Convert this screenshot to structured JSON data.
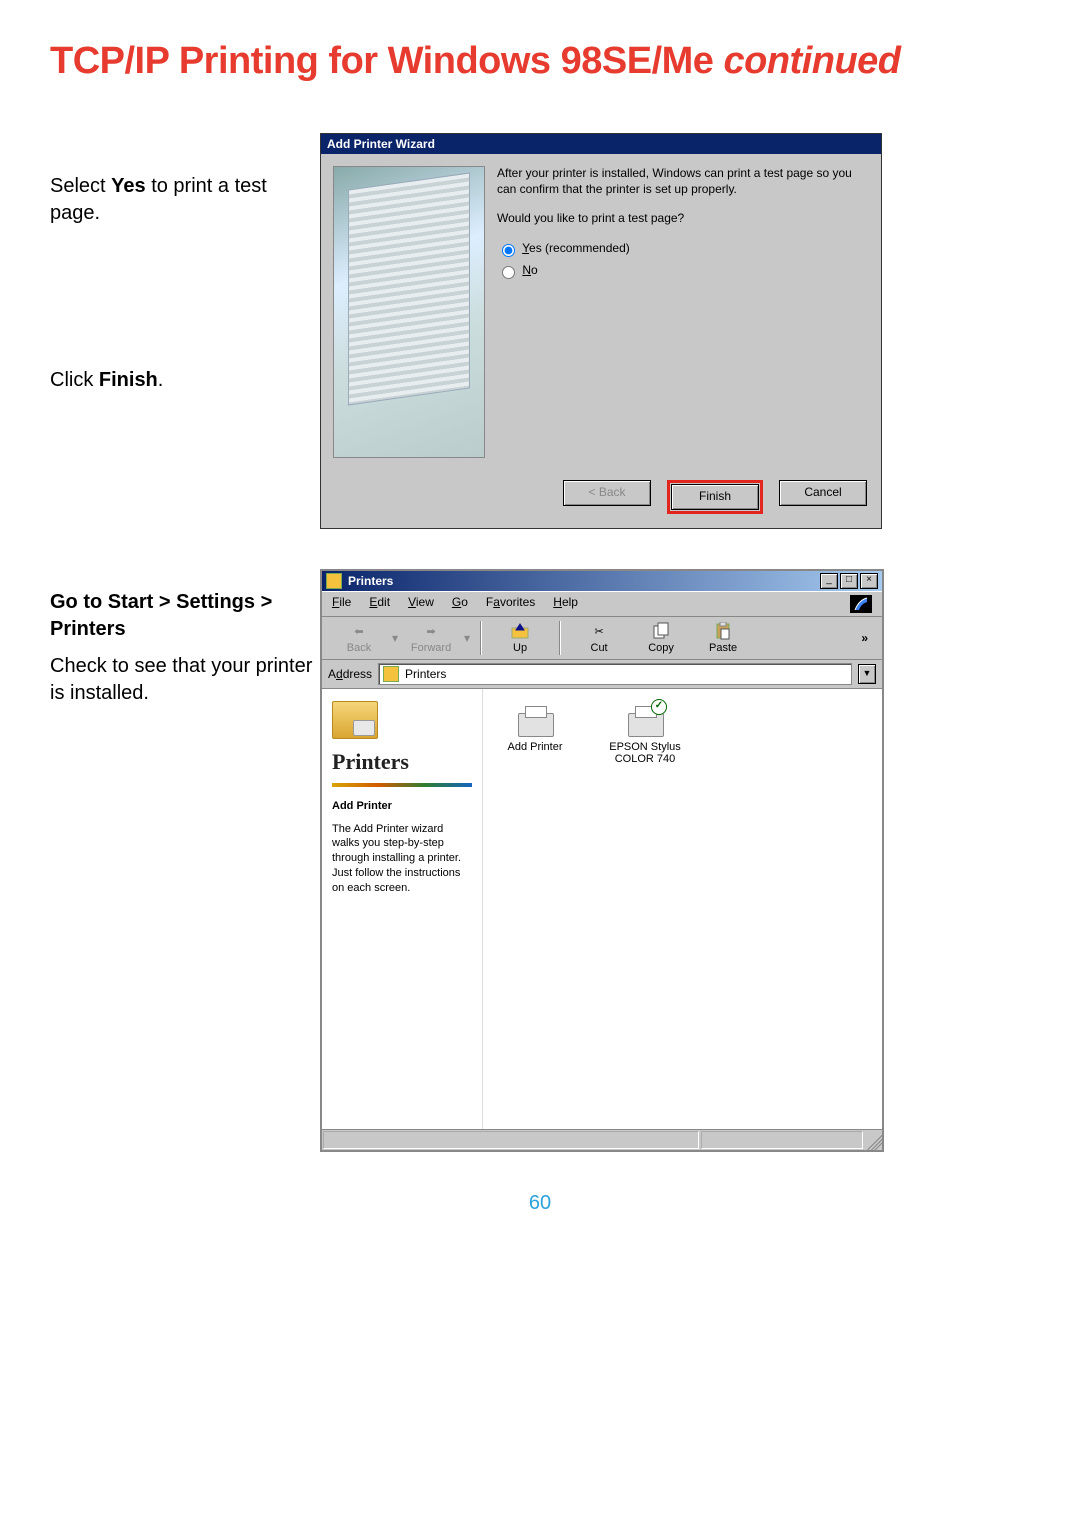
{
  "page": {
    "title_main": "TCP/IP Printing for Windows 98SE/Me ",
    "title_suffix": "continued",
    "number": "60"
  },
  "step1": {
    "line1_pre": "Select ",
    "line1_bold": "Yes",
    "line1_post": " to print a test page.",
    "line2_pre": "Click ",
    "line2_bold": "Finish",
    "line2_post": "."
  },
  "wizard": {
    "title": "Add Printer Wizard",
    "msg1": "After your printer is installed, Windows can print a test page so you can confirm that the printer is set up properly.",
    "msg2": "Would you like to print a test page?",
    "opt_yes": "Yes (recommended)",
    "opt_no": "No",
    "btn_back": "< Back",
    "btn_finish": "Finish",
    "btn_cancel": "Cancel"
  },
  "step2": {
    "line1": "Go to Start > Settings > Printers",
    "line2": "Check to see that your printer is installed."
  },
  "printers": {
    "title": "Printers",
    "menus": [
      "File",
      "Edit",
      "View",
      "Go",
      "Favorites",
      "Help"
    ],
    "toolbar": {
      "back": "Back",
      "forward": "Forward",
      "up": "Up",
      "cut": "Cut",
      "copy": "Copy",
      "paste": "Paste"
    },
    "address_label": "Address",
    "address_value": "Printers",
    "side": {
      "heading": "Printers",
      "subhead": "Add Printer",
      "desc": "The Add Printer wizard walks you step-by-step through installing a printer. Just follow the instructions on each screen."
    },
    "items": {
      "add_printer": "Add Printer",
      "printer1_l1": "EPSON Stylus",
      "printer1_l2": "COLOR 740"
    }
  }
}
